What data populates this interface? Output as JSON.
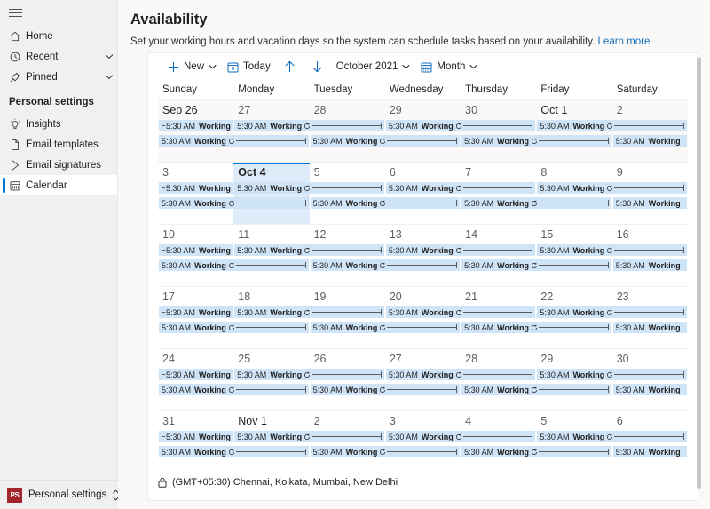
{
  "sidebar": {
    "hamburger_name": "global-nav-button",
    "items": [
      {
        "label": "Home",
        "icon": "home-icon",
        "chevron": false
      },
      {
        "label": "Recent",
        "icon": "clock-icon",
        "chevron": true
      },
      {
        "label": "Pinned",
        "icon": "pin-icon",
        "chevron": true
      }
    ],
    "section_title": "Personal settings",
    "settings_items": [
      {
        "label": "Insights",
        "icon": "lightbulb-icon",
        "selected": false
      },
      {
        "label": "Email templates",
        "icon": "document-icon",
        "selected": false
      },
      {
        "label": "Email signatures",
        "icon": "signature-icon",
        "selected": false
      },
      {
        "label": "Calendar",
        "icon": "calendar-icon",
        "selected": true
      }
    ],
    "account": {
      "initials": "PS",
      "name": "Personal settings",
      "badge_color": "#a4262c"
    }
  },
  "header": {
    "title": "Availability",
    "description": "Set your working hours and vacation days so the system can schedule tasks based on your availability.",
    "learn_more": "Learn more"
  },
  "toolbar": {
    "new_label": "New",
    "today_label": "Today",
    "prev_label": "",
    "next_label": "",
    "period_label": "October 2021",
    "view_label": "Month"
  },
  "calendar": {
    "day_headers": [
      "Sunday",
      "Monday",
      "Tuesday",
      "Wednesday",
      "Thursday",
      "Friday",
      "Saturday"
    ],
    "event_time": "5:30 AM",
    "event_title": "Working",
    "accent_color": "#0078d4",
    "event_bg": "#cfe4f6",
    "today_bg": "#deecf9",
    "weeks": [
      {
        "prev_month": true,
        "days": [
          {
            "num": "Sep 26",
            "month_start": true,
            "today": false
          },
          {
            "num": "27",
            "month_start": false,
            "today": false
          },
          {
            "num": "28",
            "month_start": false,
            "today": false
          },
          {
            "num": "29",
            "month_start": false,
            "today": false
          },
          {
            "num": "30",
            "month_start": false,
            "today": false
          },
          {
            "num": "Oct 1",
            "month_start": true,
            "today": false
          },
          {
            "num": "2",
            "month_start": false,
            "today": false
          }
        ]
      },
      {
        "prev_month": false,
        "days": [
          {
            "num": "3",
            "month_start": false,
            "today": false
          },
          {
            "num": "Oct 4",
            "month_start": true,
            "today": true
          },
          {
            "num": "5",
            "month_start": false,
            "today": false
          },
          {
            "num": "6",
            "month_start": false,
            "today": false
          },
          {
            "num": "7",
            "month_start": false,
            "today": false
          },
          {
            "num": "8",
            "month_start": false,
            "today": false
          },
          {
            "num": "9",
            "month_start": false,
            "today": false
          }
        ]
      },
      {
        "prev_month": false,
        "days": [
          {
            "num": "10",
            "month_start": false,
            "today": false
          },
          {
            "num": "11",
            "month_start": false,
            "today": false
          },
          {
            "num": "12",
            "month_start": false,
            "today": false
          },
          {
            "num": "13",
            "month_start": false,
            "today": false
          },
          {
            "num": "14",
            "month_start": false,
            "today": false
          },
          {
            "num": "15",
            "month_start": false,
            "today": false
          },
          {
            "num": "16",
            "month_start": false,
            "today": false
          }
        ]
      },
      {
        "prev_month": false,
        "days": [
          {
            "num": "17",
            "month_start": false,
            "today": false
          },
          {
            "num": "18",
            "month_start": false,
            "today": false
          },
          {
            "num": "19",
            "month_start": false,
            "today": false
          },
          {
            "num": "20",
            "month_start": false,
            "today": false
          },
          {
            "num": "21",
            "month_start": false,
            "today": false
          },
          {
            "num": "22",
            "month_start": false,
            "today": false
          },
          {
            "num": "23",
            "month_start": false,
            "today": false
          }
        ]
      },
      {
        "prev_month": false,
        "days": [
          {
            "num": "24",
            "month_start": false,
            "today": false
          },
          {
            "num": "25",
            "month_start": false,
            "today": false
          },
          {
            "num": "26",
            "month_start": false,
            "today": false
          },
          {
            "num": "27",
            "month_start": false,
            "today": false
          },
          {
            "num": "28",
            "month_start": false,
            "today": false
          },
          {
            "num": "29",
            "month_start": false,
            "today": false
          },
          {
            "num": "30",
            "month_start": false,
            "today": false
          }
        ]
      },
      {
        "prev_month": false,
        "days": [
          {
            "num": "31",
            "month_start": false,
            "today": false
          },
          {
            "num": "Nov 1",
            "month_start": true,
            "today": false
          },
          {
            "num": "2",
            "month_start": false,
            "today": false
          },
          {
            "num": "3",
            "month_start": false,
            "today": false
          },
          {
            "num": "4",
            "month_start": false,
            "today": false
          },
          {
            "num": "5",
            "month_start": false,
            "today": false
          },
          {
            "num": "6",
            "month_start": false,
            "today": false
          }
        ]
      }
    ],
    "event_rows": [
      [
        {
          "start": 0,
          "span": 1,
          "continues_before": true,
          "has_end": false
        },
        {
          "start": 1,
          "span": 2,
          "continues_before": false,
          "has_end": true
        },
        {
          "start": 3,
          "span": 2,
          "continues_before": false,
          "has_end": true
        },
        {
          "start": 5,
          "span": 2,
          "continues_before": false,
          "has_end": true
        }
      ],
      [
        {
          "start": 0,
          "span": 2,
          "continues_before": false,
          "has_end": true
        },
        {
          "start": 2,
          "span": 2,
          "continues_before": false,
          "has_end": true
        },
        {
          "start": 4,
          "span": 2,
          "continues_before": false,
          "has_end": true
        },
        {
          "start": 6,
          "span": 1,
          "continues_before": false,
          "has_end": false
        }
      ]
    ]
  },
  "footer": {
    "timezone": "(GMT+05:30) Chennai, Kolkata, Mumbai, New Delhi",
    "lock_icon": "lock-icon"
  }
}
